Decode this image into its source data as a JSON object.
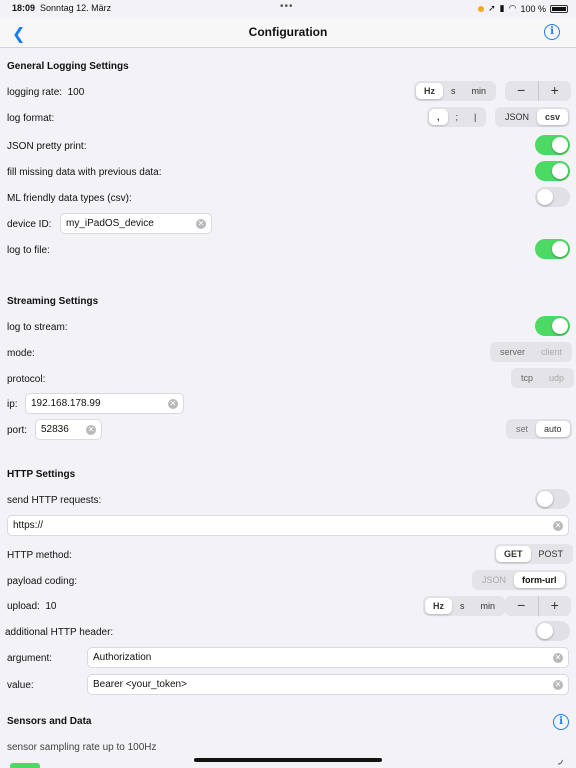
{
  "status": {
    "time": "18:09",
    "date": "Sonntag 12. März",
    "battery": "100 %"
  },
  "nav": {
    "title": "Configuration"
  },
  "general": {
    "title": "General Logging Settings",
    "rate_label": "logging rate:",
    "rate_value": "100",
    "rate_units": [
      "Hz",
      "s",
      "min"
    ],
    "rate_unit_selected": "Hz",
    "format_label": "log format:",
    "separators": [
      ",",
      ";",
      "|"
    ],
    "separator_selected": ",",
    "formats": [
      "JSON",
      "csv"
    ],
    "format_selected": "csv",
    "json_pretty_label": "JSON pretty print:",
    "json_pretty_on": true,
    "fill_missing_label": "fill missing data with previous data:",
    "fill_missing_on": true,
    "ml_friendly_label": "ML friendly data types (csv):",
    "ml_friendly_on": false,
    "device_id_label": "device ID:",
    "device_id_value": "my_iPadOS_device",
    "log_to_file_label": "log to file:",
    "log_to_file_on": true
  },
  "streaming": {
    "title": "Streaming Settings",
    "log_to_stream_label": "log to stream:",
    "log_to_stream_on": true,
    "mode_label": "mode:",
    "modes": [
      "server",
      "client"
    ],
    "protocol_label": "protocol:",
    "protocols": [
      "tcp",
      "udp"
    ],
    "ip_label": "ip:",
    "ip_value": "192.168.178.99",
    "port_label": "port:",
    "port_value": "52836",
    "port_actions": [
      "set",
      "auto"
    ],
    "port_action_selected": "auto"
  },
  "http": {
    "title": "HTTP Settings",
    "send_label": "send HTTP requests:",
    "send_on": false,
    "url_value": "https://",
    "method_label": "HTTP method:",
    "methods": [
      "GET",
      "POST"
    ],
    "method_selected": "GET",
    "coding_label": "payload coding:",
    "codings": [
      "JSON",
      "form-url"
    ],
    "coding_selected": "form-url",
    "upload_label": "upload:",
    "upload_value": "10",
    "upload_units": [
      "Hz",
      "s",
      "min"
    ],
    "upload_unit_selected": "Hz",
    "header_label": "additional HTTP header:",
    "header_on": false,
    "argument_label": "argument:",
    "argument_value": "Authorization",
    "value_label": "value:",
    "value_value": "Bearer <your_token>"
  },
  "sensors": {
    "title": "Sensors and Data",
    "sampling_text": "sensor sampling rate up to 100Hz"
  },
  "icons": {
    "back": "chevron-left-icon",
    "info": "info-circle-icon",
    "clear": "clear-circle-icon"
  },
  "colors": {
    "accent": "#1a7cf5",
    "toggle_on": "#4cd964"
  }
}
